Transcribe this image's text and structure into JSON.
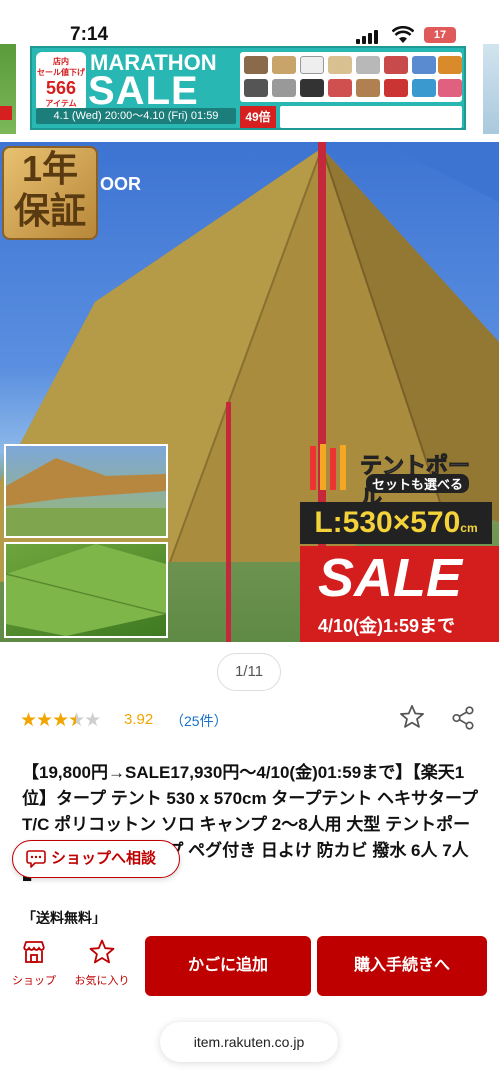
{
  "status_bar": {
    "time": "7:14",
    "battery": "17"
  },
  "banner": {
    "badge_line1": "店内",
    "badge_line1b": "セール値下げ",
    "badge_number": "566",
    "badge_line3": "アイテム",
    "title_top": "MARATHON",
    "title_main": "SALE",
    "date_range": "4.1 (Wed) 20:00～4.10 (Fri) 01:59",
    "points": "49倍"
  },
  "hero": {
    "warranty_line1": "1年",
    "warranty_line2": "保証",
    "brand_fragment": "OOR",
    "pole_label_main": "テントポール",
    "pole_label_sub": "セットも選べる",
    "size_label": "L:530×570",
    "size_unit": "cm",
    "sale_label": "SALE",
    "sale_deadline": "4/10(金)1:59まで"
  },
  "pager": {
    "text": "1/11"
  },
  "rating": {
    "value": 3.92,
    "value_text": "3.92",
    "count_text": "（25件）",
    "stars_full": 3,
    "stars_half": 1,
    "stars_total": 5
  },
  "product": {
    "title": "【19,800円→SALE17,930円～4/10(金)01:59まで】【楽天1位】タープ テント 530 x 570cm タープテント ヘキサタープ T/C ポリコットン ソロ キャンプ 2～8人用 大型 テントポール ヘキサゴン タープ ペグ付き 日よけ 防カビ 撥水 6人 7人 ■",
    "shipping": "「送料無料」"
  },
  "consult": {
    "label": "ショップへ相談"
  },
  "bottom_bar": {
    "shop_label": "ショップ",
    "fav_label": "お気に入り",
    "cart_label": "かごに追加",
    "buy_label": "購入手続きへ"
  },
  "url_bar": {
    "domain": "item.rakuten.co.jp"
  },
  "colors": {
    "rakuten_red": "#bf0000",
    "star_gold": "#f0a500",
    "link_blue": "#1a73c9",
    "banner_teal": "#29b7b3"
  }
}
